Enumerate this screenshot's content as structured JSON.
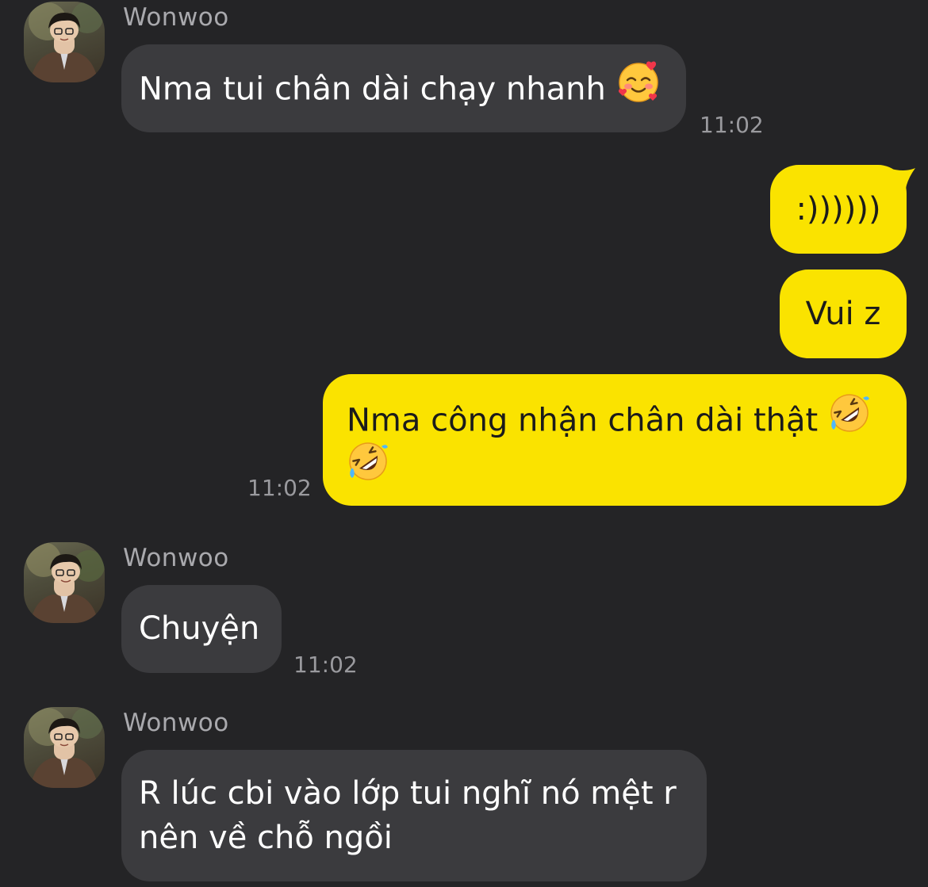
{
  "messages": [
    {
      "sender": "Wonwoo",
      "direction": "in",
      "text": "Nma tui chân dài chạy nhanh",
      "emoji": "smiling-face-with-hearts",
      "time": "11:02"
    },
    {
      "direction": "out",
      "text": ":))))))"
    },
    {
      "direction": "out",
      "text": "Vui z"
    },
    {
      "direction": "out",
      "text": "Nma công nhận chân dài thật",
      "emoji": "rolling-on-the-floor-laughing",
      "time": "11:02"
    },
    {
      "sender": "Wonwoo",
      "direction": "in",
      "text": "Chuyện",
      "time": "11:02"
    },
    {
      "sender": "Wonwoo",
      "direction": "in",
      "text_line1": "R lúc cbi vào lớp tui nghĩ nó mệt r",
      "text_line2": "nên về chỗ ngồi"
    }
  ],
  "colors": {
    "background": "#242426",
    "incoming_bubble": "#3b3b3e",
    "outgoing_bubble": "#fae300",
    "timestamp": "#9a9a9e"
  }
}
